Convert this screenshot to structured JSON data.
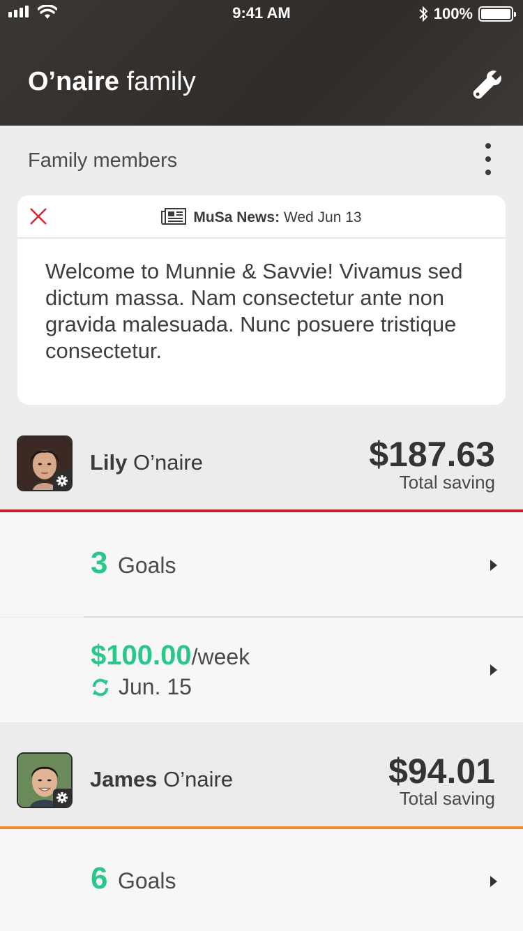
{
  "status_bar": {
    "time": "9:41 AM",
    "battery": "100%"
  },
  "header": {
    "title_bold": "O’naire",
    "title_thin": "family",
    "settings_icon": "wrench-icon"
  },
  "section": {
    "title": "Family members"
  },
  "news": {
    "source": "MuSa News:",
    "date": "Wed Jun 13",
    "body": "Welcome to Munnie & Savvie! Vivamus sed dictum massa. Nam consectetur ante non gravida malesuada. Nunc posuere tristique consectetur."
  },
  "members": [
    {
      "first": "Lily",
      "last": "O’naire",
      "total": "$187.63",
      "total_label": "Total saving",
      "goals_count": "3",
      "goals_label": "Goals",
      "allowance": "$100.00",
      "allowance_period": "/week",
      "next_date": "Jun. 15",
      "accent_color": "#c4232b"
    },
    {
      "first": "James",
      "last": "O’naire",
      "total": "$94.01",
      "total_label": "Total saving",
      "goals_count": "6",
      "goals_label": "Goals",
      "accent_color": "#f08a2a"
    }
  ],
  "colors": {
    "header_bg": "#33302e",
    "accent_green": "#2bc68a",
    "close_red": "#d0282e"
  }
}
